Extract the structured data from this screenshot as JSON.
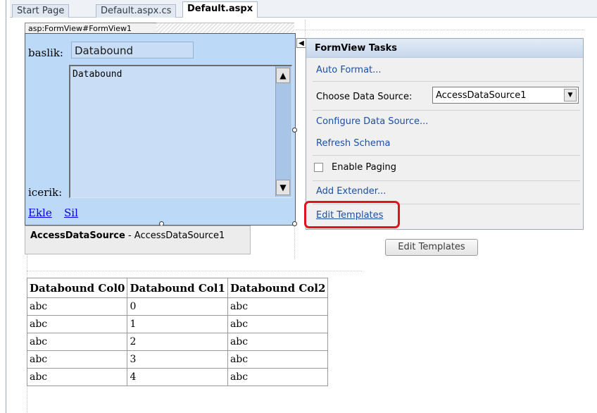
{
  "tabs": [
    {
      "label": "Start Page"
    },
    {
      "label": "Default.aspx.cs"
    },
    {
      "label": "Default.aspx"
    }
  ],
  "formview": {
    "tag": "asp:FormView#FormView1",
    "baslik_label": "baslik:",
    "baslik_value": "Databound",
    "icerik_label": "icerik:",
    "icerik_value": "Databound",
    "links": [
      "Ekle",
      "Sil"
    ]
  },
  "tasks": {
    "title": "FormView Tasks",
    "auto_format": "Auto Format...",
    "choose_ds_label": "Choose Data Source:",
    "choose_ds_value": "AccessDataSource1",
    "configure": "Configure Data Source...",
    "refresh": "Refresh Schema",
    "enable_paging": "Enable Paging",
    "add_extender": "Add Extender...",
    "edit_templates": "Edit Templates"
  },
  "datasource": {
    "type": "AccessDataSource",
    "separator": " - ",
    "id": "AccessDataSource1"
  },
  "edit_templates_button": "Edit Templates",
  "grid": {
    "headers": [
      "Databound Col0",
      "Databound Col1",
      "Databound Col2"
    ],
    "rows": [
      [
        "abc",
        "0",
        "abc"
      ],
      [
        "abc",
        "1",
        "abc"
      ],
      [
        "abc",
        "2",
        "abc"
      ],
      [
        "abc",
        "3",
        "abc"
      ],
      [
        "abc",
        "4",
        "abc"
      ]
    ]
  },
  "colors": {
    "formview_bg": "#bcdaf8",
    "link": "#1a4fa8",
    "highlight": "#e0141e"
  }
}
